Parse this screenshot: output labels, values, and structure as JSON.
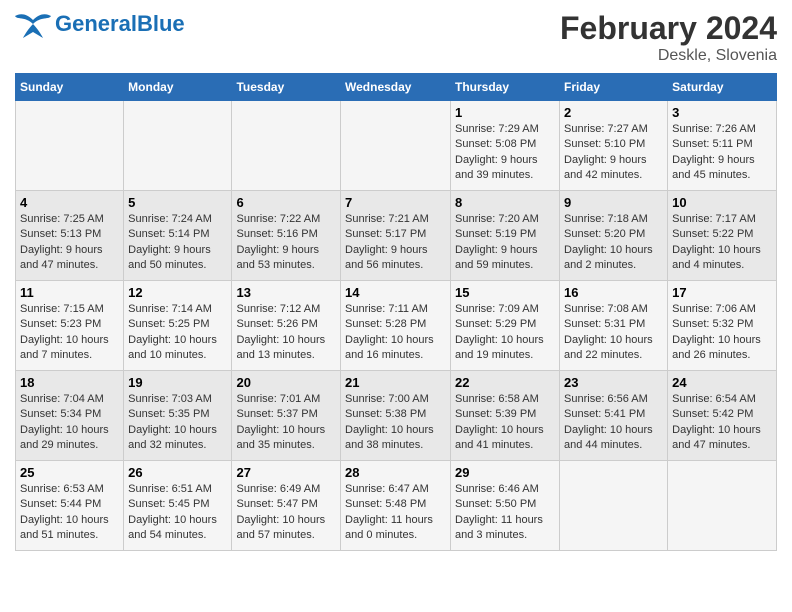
{
  "header": {
    "logo_general": "General",
    "logo_blue": "Blue",
    "title": "February 2024",
    "subtitle": "Deskle, Slovenia"
  },
  "days_of_week": [
    "Sunday",
    "Monday",
    "Tuesday",
    "Wednesday",
    "Thursday",
    "Friday",
    "Saturday"
  ],
  "weeks": [
    [
      {
        "day": "",
        "info": ""
      },
      {
        "day": "",
        "info": ""
      },
      {
        "day": "",
        "info": ""
      },
      {
        "day": "",
        "info": ""
      },
      {
        "day": "1",
        "info": "Sunrise: 7:29 AM\nSunset: 5:08 PM\nDaylight: 9 hours\nand 39 minutes."
      },
      {
        "day": "2",
        "info": "Sunrise: 7:27 AM\nSunset: 5:10 PM\nDaylight: 9 hours\nand 42 minutes."
      },
      {
        "day": "3",
        "info": "Sunrise: 7:26 AM\nSunset: 5:11 PM\nDaylight: 9 hours\nand 45 minutes."
      }
    ],
    [
      {
        "day": "4",
        "info": "Sunrise: 7:25 AM\nSunset: 5:13 PM\nDaylight: 9 hours\nand 47 minutes."
      },
      {
        "day": "5",
        "info": "Sunrise: 7:24 AM\nSunset: 5:14 PM\nDaylight: 9 hours\nand 50 minutes."
      },
      {
        "day": "6",
        "info": "Sunrise: 7:22 AM\nSunset: 5:16 PM\nDaylight: 9 hours\nand 53 minutes."
      },
      {
        "day": "7",
        "info": "Sunrise: 7:21 AM\nSunset: 5:17 PM\nDaylight: 9 hours\nand 56 minutes."
      },
      {
        "day": "8",
        "info": "Sunrise: 7:20 AM\nSunset: 5:19 PM\nDaylight: 9 hours\nand 59 minutes."
      },
      {
        "day": "9",
        "info": "Sunrise: 7:18 AM\nSunset: 5:20 PM\nDaylight: 10 hours\nand 2 minutes."
      },
      {
        "day": "10",
        "info": "Sunrise: 7:17 AM\nSunset: 5:22 PM\nDaylight: 10 hours\nand 4 minutes."
      }
    ],
    [
      {
        "day": "11",
        "info": "Sunrise: 7:15 AM\nSunset: 5:23 PM\nDaylight: 10 hours\nand 7 minutes."
      },
      {
        "day": "12",
        "info": "Sunrise: 7:14 AM\nSunset: 5:25 PM\nDaylight: 10 hours\nand 10 minutes."
      },
      {
        "day": "13",
        "info": "Sunrise: 7:12 AM\nSunset: 5:26 PM\nDaylight: 10 hours\nand 13 minutes."
      },
      {
        "day": "14",
        "info": "Sunrise: 7:11 AM\nSunset: 5:28 PM\nDaylight: 10 hours\nand 16 minutes."
      },
      {
        "day": "15",
        "info": "Sunrise: 7:09 AM\nSunset: 5:29 PM\nDaylight: 10 hours\nand 19 minutes."
      },
      {
        "day": "16",
        "info": "Sunrise: 7:08 AM\nSunset: 5:31 PM\nDaylight: 10 hours\nand 22 minutes."
      },
      {
        "day": "17",
        "info": "Sunrise: 7:06 AM\nSunset: 5:32 PM\nDaylight: 10 hours\nand 26 minutes."
      }
    ],
    [
      {
        "day": "18",
        "info": "Sunrise: 7:04 AM\nSunset: 5:34 PM\nDaylight: 10 hours\nand 29 minutes."
      },
      {
        "day": "19",
        "info": "Sunrise: 7:03 AM\nSunset: 5:35 PM\nDaylight: 10 hours\nand 32 minutes."
      },
      {
        "day": "20",
        "info": "Sunrise: 7:01 AM\nSunset: 5:37 PM\nDaylight: 10 hours\nand 35 minutes."
      },
      {
        "day": "21",
        "info": "Sunrise: 7:00 AM\nSunset: 5:38 PM\nDaylight: 10 hours\nand 38 minutes."
      },
      {
        "day": "22",
        "info": "Sunrise: 6:58 AM\nSunset: 5:39 PM\nDaylight: 10 hours\nand 41 minutes."
      },
      {
        "day": "23",
        "info": "Sunrise: 6:56 AM\nSunset: 5:41 PM\nDaylight: 10 hours\nand 44 minutes."
      },
      {
        "day": "24",
        "info": "Sunrise: 6:54 AM\nSunset: 5:42 PM\nDaylight: 10 hours\nand 47 minutes."
      }
    ],
    [
      {
        "day": "25",
        "info": "Sunrise: 6:53 AM\nSunset: 5:44 PM\nDaylight: 10 hours\nand 51 minutes."
      },
      {
        "day": "26",
        "info": "Sunrise: 6:51 AM\nSunset: 5:45 PM\nDaylight: 10 hours\nand 54 minutes."
      },
      {
        "day": "27",
        "info": "Sunrise: 6:49 AM\nSunset: 5:47 PM\nDaylight: 10 hours\nand 57 minutes."
      },
      {
        "day": "28",
        "info": "Sunrise: 6:47 AM\nSunset: 5:48 PM\nDaylight: 11 hours\nand 0 minutes."
      },
      {
        "day": "29",
        "info": "Sunrise: 6:46 AM\nSunset: 5:50 PM\nDaylight: 11 hours\nand 3 minutes."
      },
      {
        "day": "",
        "info": ""
      },
      {
        "day": "",
        "info": ""
      }
    ]
  ]
}
